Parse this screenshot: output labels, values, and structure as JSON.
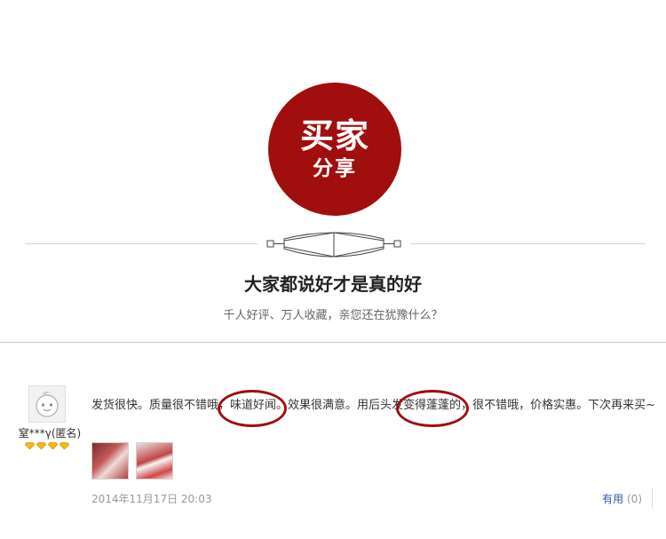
{
  "badge": {
    "line1": "买家",
    "line2": "分享",
    "color": "#a10e0e"
  },
  "heading": "大家都说好才是真的好",
  "subheading": "千人好评、万人收藏，亲您还在犹豫什么？",
  "review": {
    "username": "窒***γ(匿名)",
    "level_icon": "diamond-icon",
    "level_count": 4,
    "text_part1": "发货很快。质量很不错哦，",
    "text_highlight1": "味道好闻",
    "text_part2": "。效果很满意。用后头发",
    "text_highlight2": "变得蓬蓬的",
    "text_part3": "，很不错哦，价格实惠。下次再来买~",
    "timestamp": "2014年11月17日 20:03",
    "useful_label": "有用",
    "useful_count": "(0)"
  },
  "colors": {
    "accent": "#a10e0e",
    "link": "#3355aa"
  }
}
